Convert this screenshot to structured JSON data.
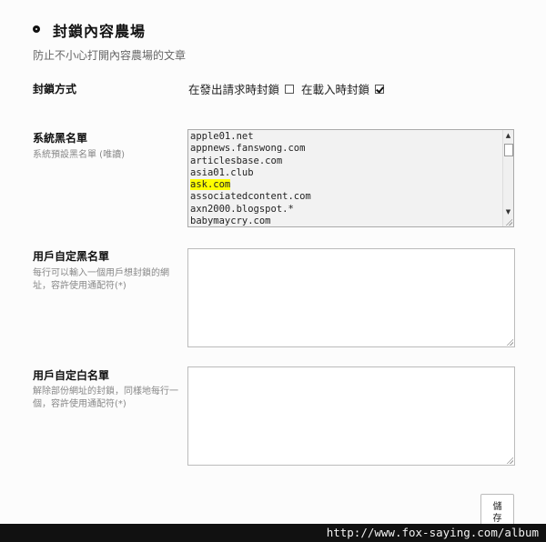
{
  "section": {
    "title": "封鎖內容農場",
    "subtitle": "防止不小心打開內容農場的文章"
  },
  "block_mode": {
    "label": "封鎖方式",
    "option_request": {
      "label": "在發出請求時封鎖",
      "checked": false
    },
    "option_load": {
      "label": "在載入時封鎖",
      "checked": true
    }
  },
  "system_blacklist": {
    "label": "系統黑名單",
    "help": "系統預設黑名單 (唯讀)",
    "items": [
      "apple01.net",
      "appnews.fanswong.com",
      "articlesbase.com",
      "asia01.club",
      "ask.com",
      "associatedcontent.com",
      "axn2000.blogspot.*",
      "babymaycry.com"
    ],
    "highlighted_item": "ask.com",
    "highlight_color": "#ffff00"
  },
  "user_blacklist": {
    "label": "用戶自定黑名單",
    "help": "每行可以輸入一個用戶想封鎖的網址，容許使用通配符(*)",
    "value": ""
  },
  "user_whitelist": {
    "label": "用戶自定白名單",
    "help": "解除部份網址的封鎖，同樣地每行一個，容許使用通配符(*)",
    "value": ""
  },
  "save_button": {
    "label_line1": "儲",
    "label_line2": "存"
  },
  "watermark": "http://www.fox-saying.com/album"
}
